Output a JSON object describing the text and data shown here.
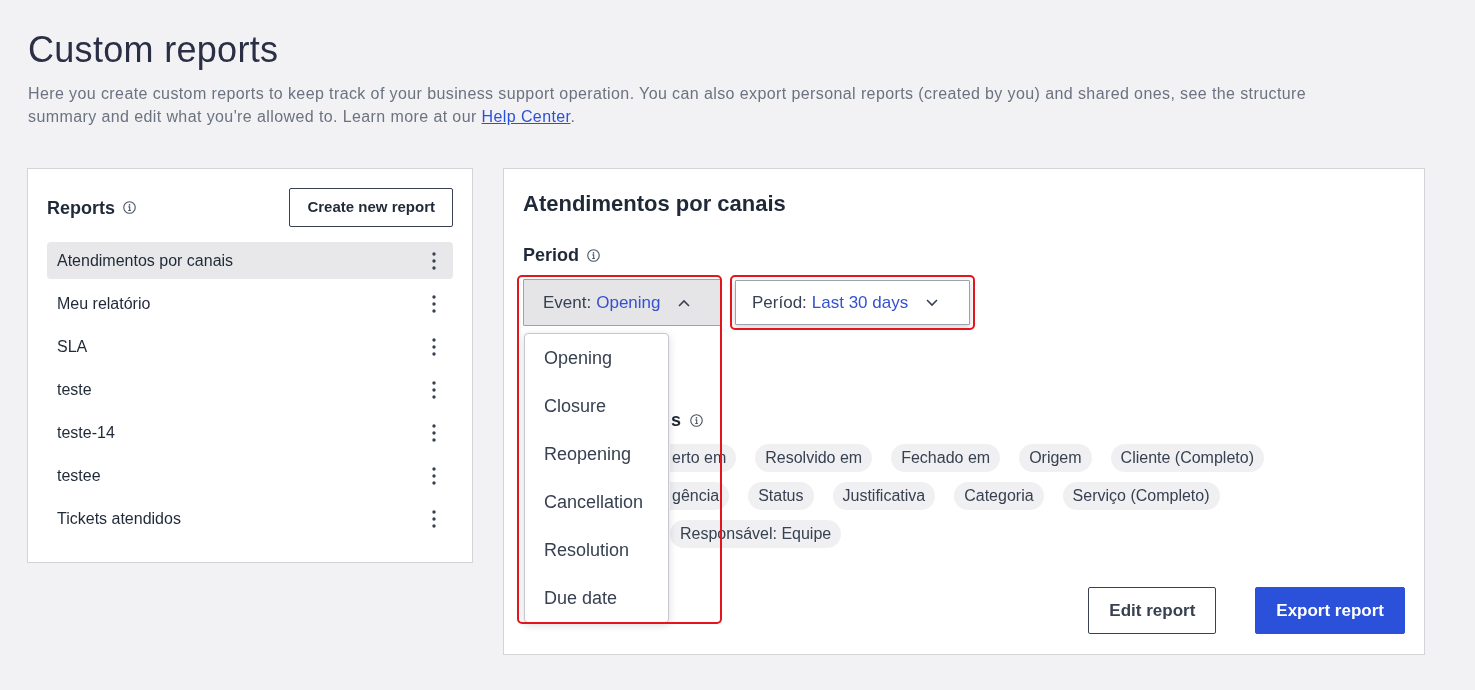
{
  "header": {
    "title": "Custom reports",
    "description": "Here you create custom reports to keep track of your business support operation. You can also export personal reports (created by you) and shared ones, see the structure summary and edit what you're allowed to. Learn more at our ",
    "link": "Help Center",
    "description_end": "."
  },
  "reports": {
    "title": "Reports",
    "create_button": "Create new report",
    "items": [
      {
        "label": "Atendimentos por canais",
        "selected": true
      },
      {
        "label": "Meu relatório",
        "selected": false
      },
      {
        "label": "SLA",
        "selected": false
      },
      {
        "label": "teste",
        "selected": false
      },
      {
        "label": "teste-14",
        "selected": false
      },
      {
        "label": "testee",
        "selected": false
      },
      {
        "label": "Tickets atendidos",
        "selected": false
      }
    ]
  },
  "report_detail": {
    "title": "Atendimentos por canais",
    "period": {
      "label": "Period",
      "event": {
        "label": "Event:",
        "value": "Opening",
        "expanded": true,
        "highlighted": true,
        "options": [
          "Opening",
          "Closure",
          "Reopening",
          "Cancellation",
          "Resolution",
          "Due date"
        ]
      },
      "range": {
        "label": "Períod:",
        "value": "Last 30 days",
        "expanded": false,
        "highlighted": true
      }
    },
    "fields": {
      "title": "s",
      "rows": [
        [
          {
            "label": "erto em",
            "kind": "cut"
          },
          {
            "label": "Resolvido em",
            "kind": "full"
          },
          {
            "label": "Fechado em",
            "kind": "full"
          },
          {
            "label": "Origem",
            "kind": "full"
          },
          {
            "label": "Cliente (Completo)",
            "kind": "full"
          }
        ],
        [
          {
            "label": "gência",
            "kind": "cut"
          },
          {
            "label": "Status",
            "kind": "full"
          },
          {
            "label": "Justificativa",
            "kind": "full"
          },
          {
            "label": "Categoria",
            "kind": "full"
          },
          {
            "label": "Serviço (Completo)",
            "kind": "full"
          }
        ],
        [
          {
            "label": "Responsável: Equipe",
            "kind": "full"
          }
        ]
      ]
    },
    "buttons": [
      {
        "label": "Edit report",
        "kind": "secondary"
      },
      {
        "label": "Export report",
        "kind": "primary"
      }
    ]
  }
}
